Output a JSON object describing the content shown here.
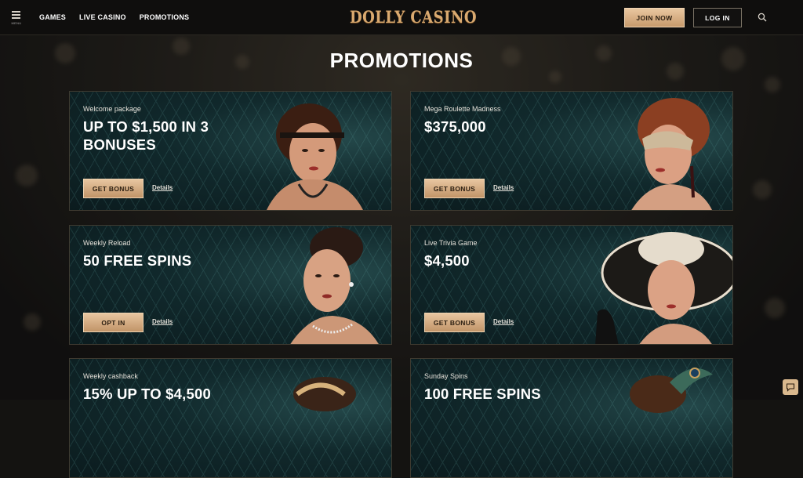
{
  "header": {
    "menu_caption": "MENU",
    "nav": [
      "GAMES",
      "LIVE CASINO",
      "PROMOTIONS"
    ],
    "logo": "DOLLY CASINO",
    "join_label": "JOIN NOW",
    "login_label": "LOG IN"
  },
  "page": {
    "title": "PROMOTIONS"
  },
  "promotions": [
    {
      "label": "Welcome package",
      "headline": "UP TO $1,500 IN 3 BONUSES",
      "cta": "GET BONUS",
      "details": "Details"
    },
    {
      "label": "Mega Roulette Madness",
      "headline": "$375,000",
      "cta": "GET BONUS",
      "details": "Details"
    },
    {
      "label": "Weekly Reload",
      "headline": "50 FREE SPINS",
      "cta": "OPT IN",
      "details": "Details"
    },
    {
      "label": "Live Trivia Game",
      "headline": "$4,500",
      "cta": "GET BONUS",
      "details": "Details"
    },
    {
      "label": "Weekly cashback",
      "headline": "15% UP TO $4,500",
      "cta": "",
      "details": ""
    },
    {
      "label": "Sunday Spins",
      "headline": "100 FREE SPINS",
      "cta": "",
      "details": ""
    }
  ],
  "icons": {
    "menu": "hamburger-menu-icon",
    "search": "search-icon",
    "chat": "chat-icon"
  },
  "colors": {
    "accent_gold": "#d9a96f",
    "button_gold": "#e8c6a0",
    "card_teal": "#11292c",
    "header_bg": "#0f0e0d"
  }
}
